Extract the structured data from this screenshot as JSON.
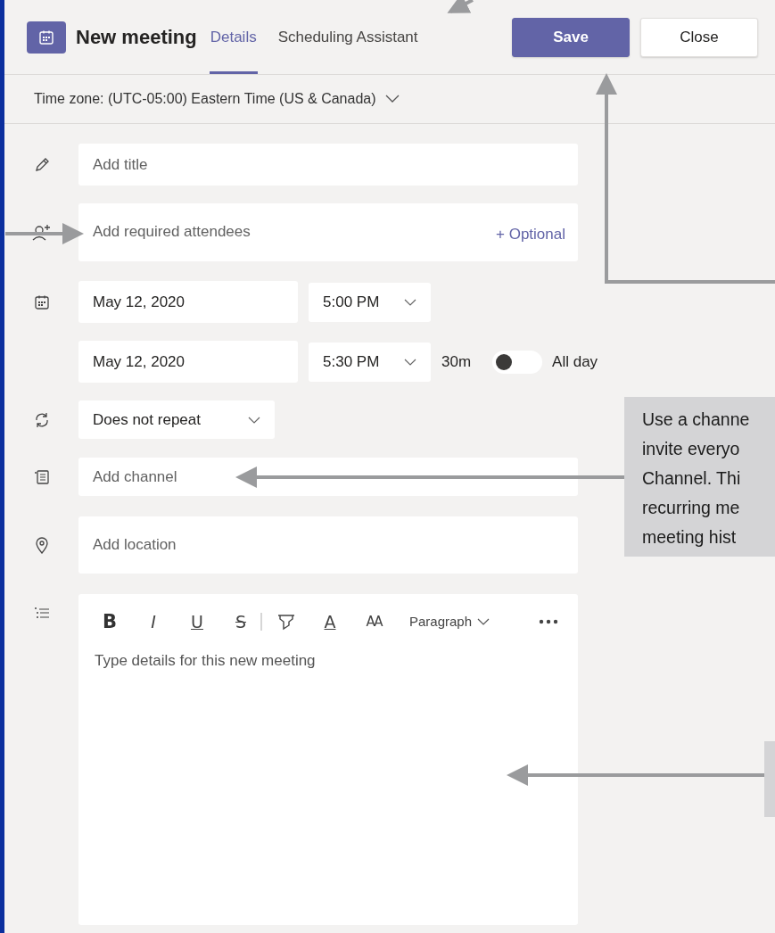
{
  "header": {
    "title": "New meeting",
    "tabs": [
      {
        "label": "Details",
        "selected": true
      },
      {
        "label": "Scheduling Assistant",
        "selected": false
      }
    ],
    "buttons": [
      {
        "label": "Save",
        "kind": "primary"
      },
      {
        "label": "Close",
        "kind": "secondary"
      }
    ]
  },
  "time_zone": "Time zone: (UTC-05:00) Eastern Time (US & Canada)",
  "title_field": {
    "placeholder": "Add title"
  },
  "attendees_field": {
    "placeholder": "Add required attendees",
    "optional_link": "+ Optional"
  },
  "start": {
    "date": "May 12, 2020",
    "time": "5:00 PM"
  },
  "end": {
    "date": "May 12, 2020",
    "time": "5:30 PM",
    "duration": "30m"
  },
  "all_day": {
    "label": "All day",
    "on": false
  },
  "repeat": {
    "value": "Does not repeat"
  },
  "channel_field": {
    "placeholder": "Add channel"
  },
  "location_field": {
    "placeholder": "Add location"
  },
  "details": {
    "toolbar": [
      {
        "kind": "bold",
        "label": "B"
      },
      {
        "kind": "italic",
        "label": "I"
      },
      {
        "kind": "underline",
        "label": "U"
      },
      {
        "kind": "strike",
        "label": "S"
      },
      {
        "kind": "divider"
      },
      {
        "kind": "highlight"
      },
      {
        "kind": "font-color",
        "label": "A"
      },
      {
        "kind": "font-size",
        "label": "AA"
      }
    ],
    "style_dropdown": "Paragraph",
    "placeholder": "Type details for this new meeting"
  },
  "callouts": [
    {
      "lines": [
        "Use a channe",
        "invite everyo",
        "Channel. Thi",
        "recurring me",
        "meeting hist"
      ]
    }
  ]
}
